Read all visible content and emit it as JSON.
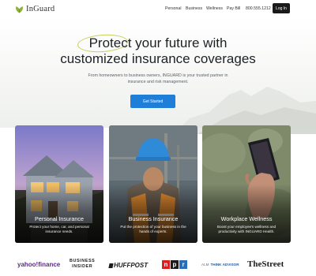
{
  "brand": {
    "name": "InGuard"
  },
  "nav": {
    "links": [
      {
        "label": "Personal"
      },
      {
        "label": "Business"
      },
      {
        "label": "Wellness"
      },
      {
        "label": "Pay Bill"
      }
    ],
    "phone": "800.555.1212",
    "login_label": "Log In"
  },
  "hero": {
    "headline_highlight": "Protect",
    "headline_rest_line1": " your future with",
    "headline_line2": "customized insurance coverages",
    "subtext": "From homeowners to business owners, INGUARD is your trusted partner in insurance and risk management.",
    "cta_label": "Get Started"
  },
  "cards": [
    {
      "title": "Personal Insurance",
      "description": "Protect your home, car, and personal insurance needs."
    },
    {
      "title": "Business Insurance",
      "description": "Put the protection of your business in the hands of experts."
    },
    {
      "title": "Workplace Wellness",
      "description": "Boost your employee's wellness and productivity with INGUARD Health."
    }
  ],
  "press": {
    "yahoo": "yahoo!finance",
    "business_insider_1": "BUSINESS",
    "business_insider_2": "INSIDER",
    "huffpost": "HUFFPOST",
    "npr_n": "n",
    "npr_p": "p",
    "npr_r": "r",
    "thinkadvisor_prefix": "ALM",
    "thinkadvisor": "THINK ADVISOR",
    "thestreet": "TheStreet"
  },
  "colors": {
    "accent": "#1f7ed8",
    "dark_button": "#1a1a1a",
    "logo_green": "#8bb339",
    "highlight_ring": "#c7cf5a"
  }
}
